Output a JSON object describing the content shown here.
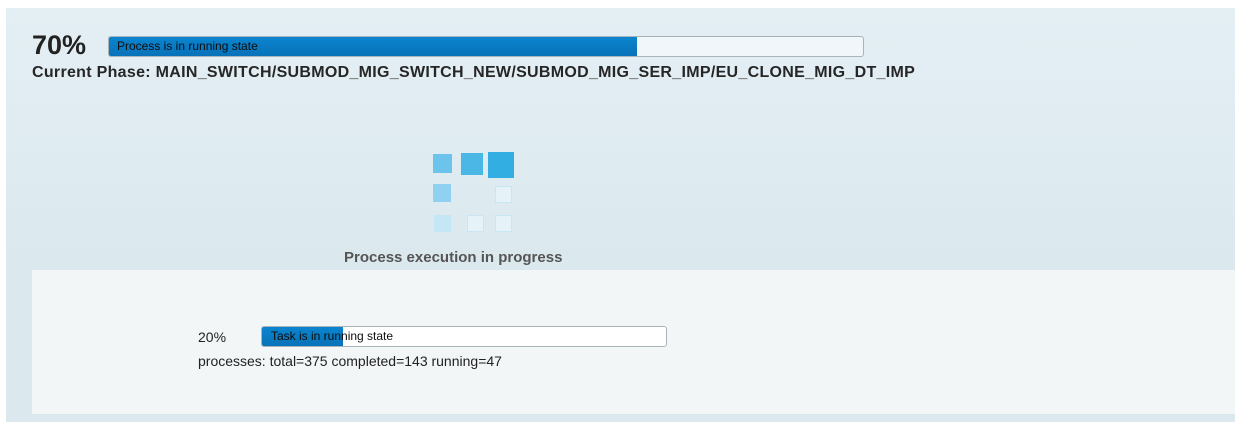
{
  "overall": {
    "percent_label": "70%",
    "progress_fraction": 0.7,
    "bar_text": "Process is in running state",
    "current_phase": "Current Phase: MAIN_SWITCH/SUBMOD_MIG_SWITCH_NEW/SUBMOD_MIG_SER_IMP/EU_CLONE_MIG_DT_IMP"
  },
  "spinner": {
    "status_text": "Process execution in progress"
  },
  "task": {
    "percent_label": "20%",
    "progress_fraction": 0.2,
    "bar_text": "Task is in running state",
    "processes_text": "processes: total=375 completed=143 running=47"
  },
  "colors": {
    "progress_fill": "#0b7dc4",
    "spinner_dark": "#33aee2",
    "spinner_mid": "#6cc4ec",
    "spinner_light": "#b7e1f4"
  }
}
